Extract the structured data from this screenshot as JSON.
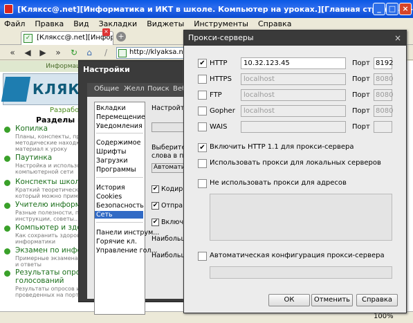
{
  "window": {
    "title": "[Кляксс@.net][Информатика и ИКТ в школе. Компьютер на уроках.][Главная страница] - Opera",
    "min_label": "_",
    "max_label": "□",
    "close_label": "×"
  },
  "menu": {
    "items": [
      "Файл",
      "Правка",
      "Вид",
      "Закладки",
      "Виджеты",
      "Инструменты",
      "Справка"
    ]
  },
  "tabs": {
    "active_label": "[Кляксс@.net][Информа...",
    "close_label": "×",
    "new_label": "+"
  },
  "address": {
    "url": "http://klyaksa.net/"
  },
  "webpage": {
    "header": "Информаци",
    "logo_text": "КЛЯКС",
    "dev_text": "Разрабо",
    "sections_title": "Разделы по",
    "items": [
      {
        "title": "Копилка",
        "desc": "Планы, конспекты, пре\nметодические находк\nматериал к уроку"
      },
      {
        "title": "Паутинка",
        "desc": "Настройка и использо\nкомпьютерной сети"
      },
      {
        "title": "Конспекты школьни",
        "desc": "Краткий теоретическ\nкоторый можно прим"
      },
      {
        "title": "Учителю информа",
        "desc": "Разные полезности, п\nинструкции, советы..."
      },
      {
        "title": "Компьютер и здоро",
        "desc": "Как сохранить здоров\nинформатики"
      },
      {
        "title": "Экзамен по информ",
        "desc": "Примерные экзамена\nи ответы"
      },
      {
        "title": "Результаты опросо\nголосований",
        "desc": "Результаты опросов и\nпроведенных на порт"
      }
    ],
    "zoom": "100%"
  },
  "settings": {
    "title": "Настройки",
    "tabs": [
      "Общие",
      "Желл",
      "Поиск",
      "Веб"
    ],
    "list_group1": [
      "Вкладки",
      "Перемещение",
      "Уведомления"
    ],
    "list_group2": [
      "Содержимое",
      "Шрифты",
      "Загрузки",
      "Программы"
    ],
    "list_group3": [
      "История",
      "Cookies",
      "Безопасность",
      "Сеть"
    ],
    "list_group4": [
      "Панели инструм...",
      "Горячие кл.",
      "Управление гол..."
    ],
    "right_texts": [
      "Настройте п",
      "Выберите, к",
      "слова в поле",
      "Автоматич",
      "Кодиров",
      "Отправ",
      "Включи",
      "Наибольшее",
      "Наибольшее"
    ]
  },
  "proxy": {
    "title": "Прокси-серверы",
    "close_label": "×",
    "rows": [
      {
        "label": "HTTP",
        "checked": true,
        "host": "10.32.123.45",
        "port": "8192",
        "enabled": true
      },
      {
        "label": "HTTPS",
        "checked": false,
        "host": "localhost",
        "port": "8080",
        "enabled": false
      },
      {
        "label": "FTP",
        "checked": false,
        "host": "localhost",
        "port": "8080",
        "enabled": false
      },
      {
        "label": "Gopher",
        "checked": false,
        "host": "localhost",
        "port": "8080",
        "enabled": false
      },
      {
        "label": "WAIS",
        "checked": false,
        "host": "",
        "port": "",
        "enabled": false
      }
    ],
    "port_label": "Порт",
    "opt_http11": "Включить HTTP 1.1 для прокси-сервера",
    "opt_local": "Использовать прокси для локальных серверов",
    "opt_noproxy": "Не использовать прокси для адресов",
    "opt_auto": "Автоматическая конфигурация прокси-сервера",
    "ok": "ОК",
    "cancel": "Отменить",
    "help": "Справка",
    "check_mark": "✔"
  }
}
